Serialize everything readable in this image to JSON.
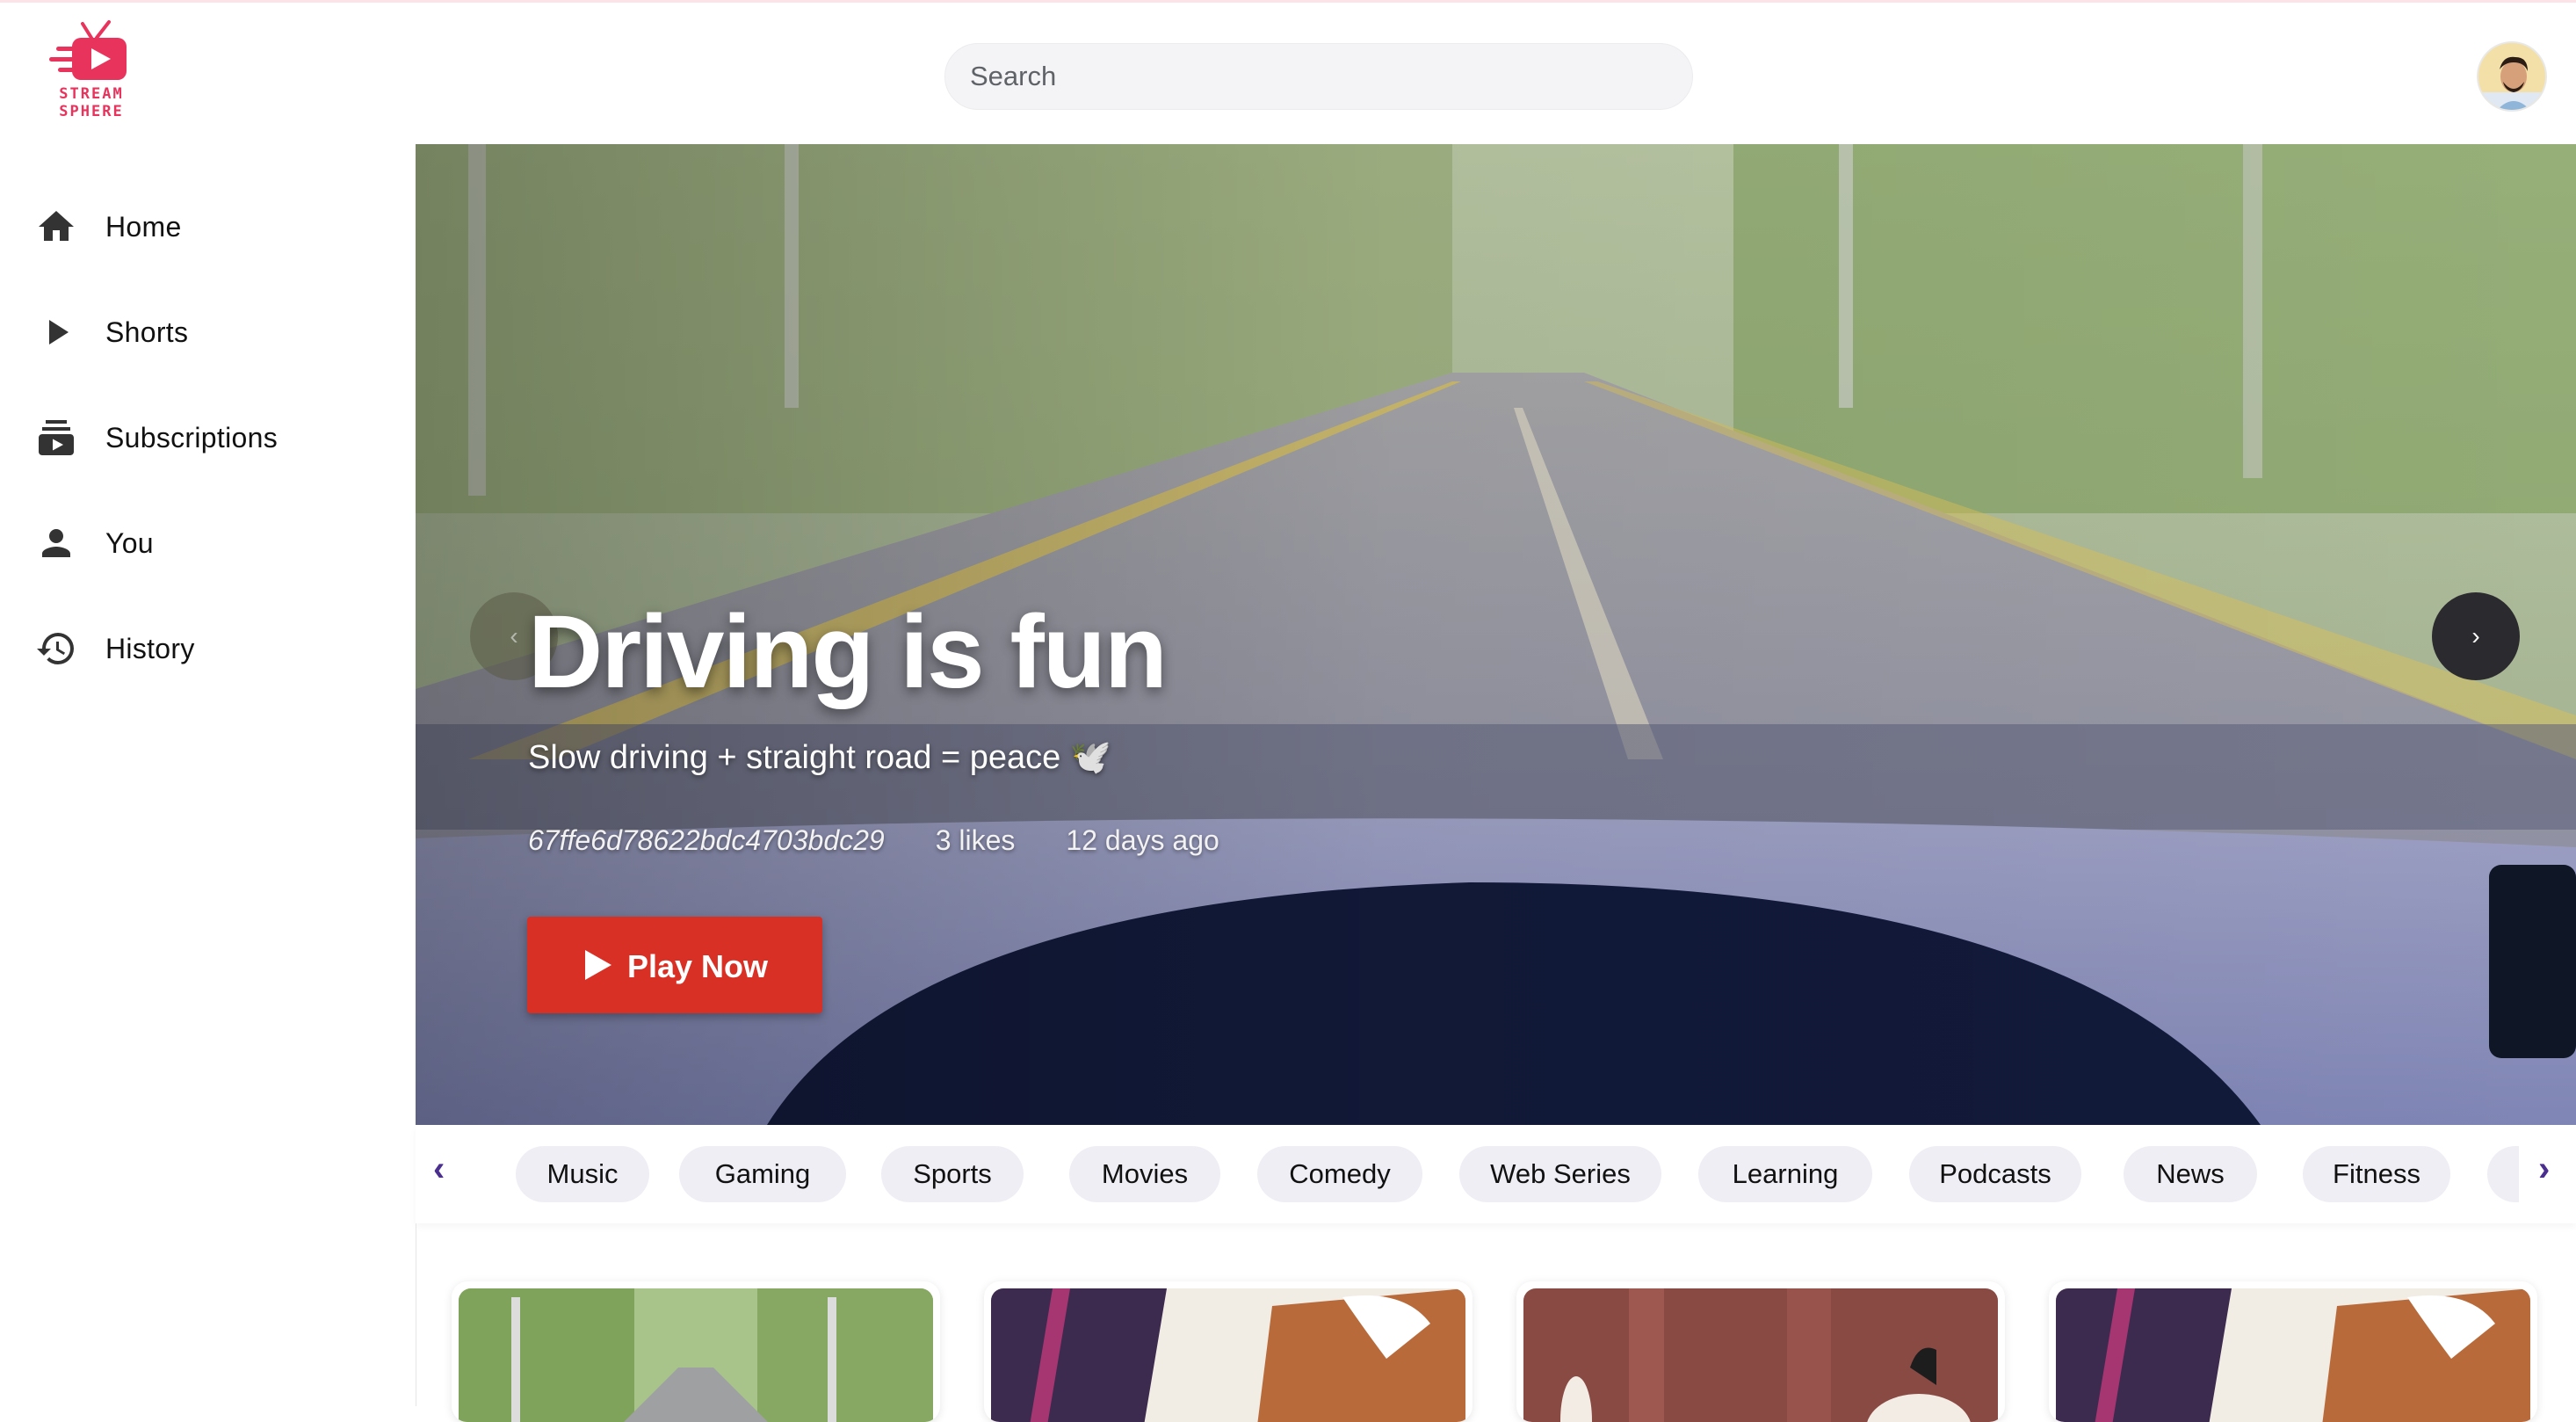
{
  "app": {
    "logo_line1": "STREAM",
    "logo_line2": "SPHERE",
    "brand_color": "#e8335d"
  },
  "search": {
    "placeholder": "Search",
    "value": ""
  },
  "sidebar": {
    "items": [
      {
        "label": "Home",
        "icon": "home-icon"
      },
      {
        "label": "Shorts",
        "icon": "play-icon"
      },
      {
        "label": "Subscriptions",
        "icon": "subscriptions-icon"
      },
      {
        "label": "You",
        "icon": "person-icon"
      },
      {
        "label": "History",
        "icon": "history-icon"
      }
    ]
  },
  "hero": {
    "title": "Driving is fun",
    "subtitle": "Slow driving + straight road = peace 🕊️",
    "video_id": "67ffe6d78622bdc4703bdc29",
    "likes": "3 likes",
    "age": "12 days ago",
    "play_label": "Play Now",
    "prev_label": "‹",
    "next_label": "›",
    "accent": "#d93025"
  },
  "categories": {
    "prev_label": "‹",
    "next_label": "›",
    "items": [
      "Music",
      "Gaming",
      "Sports",
      "Movies",
      "Comedy",
      "Web Series",
      "Learning",
      "Podcasts",
      "News",
      "Fitness"
    ]
  }
}
